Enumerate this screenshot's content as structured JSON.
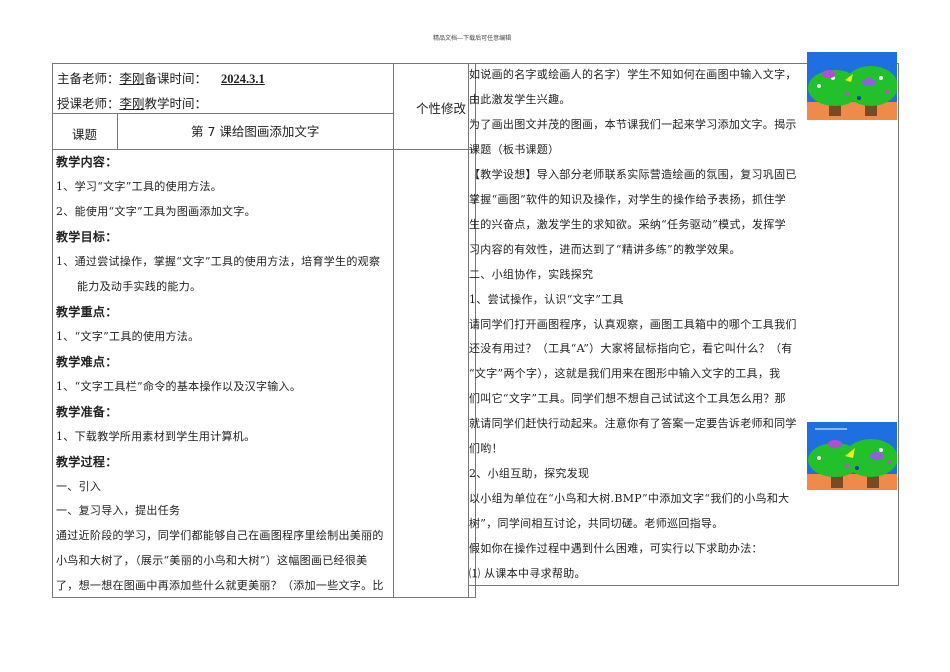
{
  "header_note": "精品文档---下载后可任意编辑",
  "info": {
    "main_teacher_label": "主备老师：",
    "main_teacher": "李刚",
    "prep_time_label": "备课时间：",
    "prep_time": "2024.3.1",
    "teacher_label": "授课老师：",
    "teacher": "李刚",
    "teach_time_label": "教学时间："
  },
  "personal_edit_label": "个性修改",
  "topic_label": "课题",
  "topic": "第 7 课给图画添加文字",
  "left_lines": [
    {
      "text": "教学内容：",
      "bold": true
    },
    {
      "text": "1、学习“文字”工具的使用方法。"
    },
    {
      "text": "2、能使用“文字”工具为图画添加文字。"
    },
    {
      "text": "教学目标：",
      "bold": true
    },
    {
      "text": "1、通过尝试操作，掌握“文字”工具的使用方法，培育学生的观察"
    },
    {
      "text": "能力及动手实践的能力。",
      "indent": true
    },
    {
      "text": "教学重点：",
      "bold": true
    },
    {
      "text": "1、“文字”工具的使用方法。"
    },
    {
      "text": "教学难点：",
      "bold": true
    },
    {
      "text": "1、“文字工具栏”命令的基本操作以及汉字输入。"
    },
    {
      "text": "教学准备：",
      "bold": true
    },
    {
      "text": "1、下载教学所用素材到学生用计算机。"
    },
    {
      "text": "教学过程：",
      "bold": true
    },
    {
      "text": "一、引入"
    },
    {
      "text": "一、复习导入，提出任务"
    },
    {
      "text": "通过近阶段的学习，同学们都能够自己在画图程序里绘制出美丽的"
    },
    {
      "text": "小鸟和大树了，（展示“美丽的小鸟和大树”）这幅图画已经很美"
    },
    {
      "text": "了，想一想在图画中再添加些什么就更美丽？（添加一些文字。比"
    }
  ],
  "right_lines": [
    "如说画的名字或绘画人的名字）学生不知如何在画图中输入文字，",
    "由此激发学生兴趣。",
    "为了画出图文并茂的图画，本节课我们一起来学习添加文字。揭示",
    "课题（板书课题）",
    "【教学设想】导入部分老师联系实际营造绘画的氛围，复习巩固已",
    "掌握“画图”软件的知识及操作，对学生的操作给予表扬，抓住学",
    "生的兴奋点，激发学生的求知欲。采纳“任务驱动”模式，发挥学",
    "习内容的有效性，进而达到了“精讲多练”的教学效果。",
    "二、小组协作，实践探究",
    "1、尝试操作，认识“文字”工具",
    "请同学们打开画图程序，认真观察，画图工具箱中的哪个工具我们",
    "还没有用过？（工具“A”）大家将鼠标指向它，看它叫什么？（有",
    "“文字”两个字），这就是我们用来在图形中输入文字的工具，我",
    "们叫它“文字”工具。同学们想不想自己试试这个工具怎么用？那",
    "就请同学们赶快行动起来。注意你有了答案一定要告诉老师和同学",
    "们哟！",
    "2、小组互助，探究发现",
    "以小组为单位在“小鸟和大树.BMP”中添加文字“我们的小鸟和大",
    "树”，同学间相互讨论，共同切磋。老师巡回指导。",
    "假如你在操作过程中遇到什么困难，可实行以下求助办法：",
    "⑴ 从课本中寻求帮助。"
  ],
  "colors": {
    "sky": "#1f6fe0",
    "tree": "#22c02a",
    "ground": "#f08a4b",
    "trunk": "#7a4a24"
  }
}
